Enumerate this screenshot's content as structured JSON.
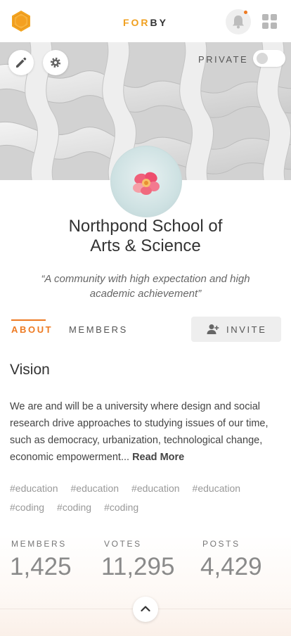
{
  "header": {
    "brand_part1": "FOR",
    "brand_part2": "BY",
    "logo_icon": "hexagon-logo-icon",
    "notification_icon": "bell-icon",
    "menu_icon": "grid-apps-icon",
    "accent_color": "#ee7a22"
  },
  "cover": {
    "edit_icon": "pencil-icon",
    "settings_icon": "gear-icon",
    "private_label": "PRIVATE",
    "private_enabled": false
  },
  "profile": {
    "name_line1": "Northpond School of",
    "name_line2": "Arts & Science",
    "quote": "“A community with high expectation and high academic achievement”"
  },
  "tabs": {
    "about": "ABOUT",
    "members": "MEMBERS",
    "invite": "INVITE",
    "active": "about"
  },
  "vision": {
    "heading": "Vision",
    "body": "We are and will be a university where design and social research drive approaches to studying issues of our time, such as democracy, urbanization, technological change, economic empowerment... ",
    "read_more": "Read More"
  },
  "tags": [
    "#education",
    "#education",
    "#education",
    "#education",
    "#coding",
    "#coding",
    "#coding"
  ],
  "stats": {
    "members_label": "MEMBERS",
    "members_value": "1,425",
    "votes_label": "VOTES",
    "votes_value": "11,295",
    "posts_label": "POSTS",
    "posts_value": "4,429"
  }
}
